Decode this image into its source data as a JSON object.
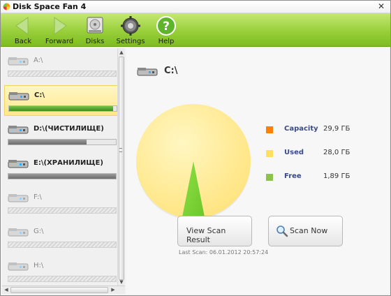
{
  "app": {
    "title": "Disk Space Fan 4"
  },
  "toolbar": {
    "back": "Back",
    "forward": "Forward",
    "disks": "Disks",
    "settings": "Settings",
    "help": "Help"
  },
  "drives": [
    {
      "name": "A:\\",
      "used_fraction": 0,
      "empty": true,
      "selected": false
    },
    {
      "name": "C:\\",
      "used_fraction": 0.97,
      "empty": false,
      "selected": true
    },
    {
      "name": "D:\\(ЧИСТИЛИЩЕ)",
      "used_fraction": 0.73,
      "empty": false,
      "selected": false
    },
    {
      "name": "E:\\(ХРАНИЛИЩЕ)",
      "used_fraction": 1.0,
      "empty": false,
      "selected": false
    },
    {
      "name": "F:\\",
      "used_fraction": 0,
      "empty": true,
      "selected": false
    },
    {
      "name": "G:\\",
      "used_fraction": 0,
      "empty": true,
      "selected": false
    },
    {
      "name": "H:\\",
      "used_fraction": 0,
      "empty": true,
      "selected": false
    }
  ],
  "details": {
    "drive_name": "C:\\",
    "legend": [
      {
        "label": "Capacity",
        "value": "29,9 ГБ",
        "color": "#ff7f00"
      },
      {
        "label": "Used",
        "value": "28,0 ГБ",
        "color": "#ffdf60"
      },
      {
        "label": "Free",
        "value": "1,89 ГБ",
        "color": "#8cc34a"
      }
    ],
    "pie": {
      "used": 28.0,
      "free": 1.89
    },
    "view_scan_label": "View Scan Result",
    "scan_now_label": "Scan Now",
    "last_scan": "Last Scan: 06.01.2012 20:57:24"
  },
  "colors": {
    "toolbar_green": "#98cf3a",
    "selected_bar": "#3c8f1b",
    "pie_used": "#ffe27a",
    "pie_free": "#6cc62a"
  }
}
